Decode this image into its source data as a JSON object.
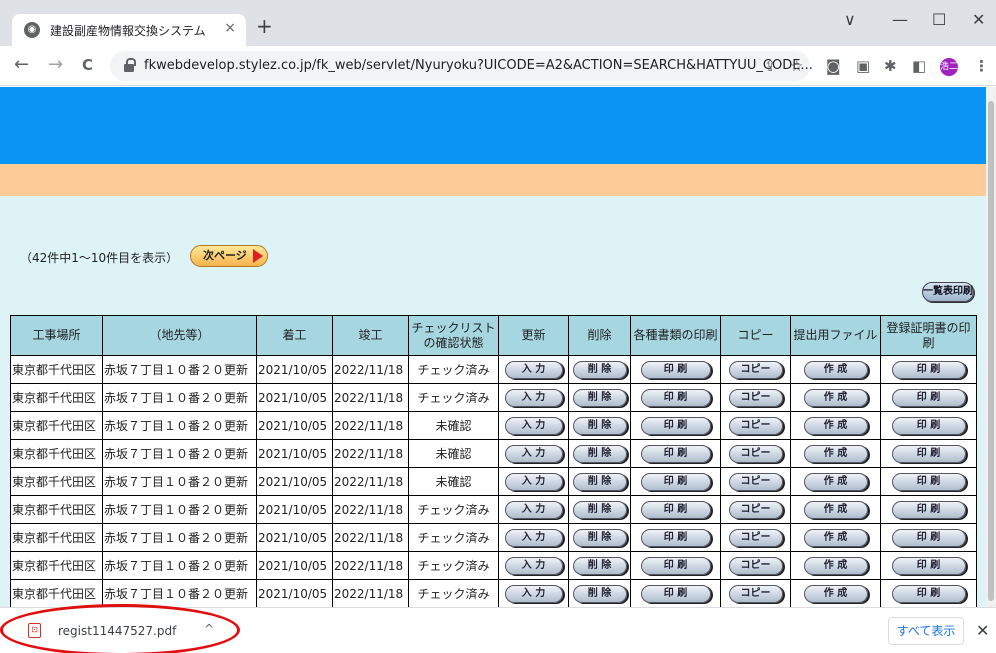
{
  "browser": {
    "tab_title": "建設副産物情報交換システム",
    "tab_close": "×",
    "new_tab": "+",
    "window_controls": {
      "chevron": "∨",
      "minimize": "—",
      "maximize": "☐",
      "close": "✕"
    },
    "back": "←",
    "forward": "→",
    "reload": "C",
    "url": "fkwebdevelop.stylez.co.jp/fk_web/servlet/Nyuryoku?UICODE=A2&ACTION=SEARCH&HATTYUU_CODE...",
    "toolbar_icons": [
      "share-icon",
      "star-icon",
      "camera-icon",
      "extension-icon",
      "puzzle-icon",
      "sidebar-icon"
    ],
    "share_glyph": "⇪",
    "star_glyph": "☆",
    "camera_glyph": "◙",
    "extension_glyph": "▣",
    "puzzle_glyph": "✱",
    "sidebar_glyph": "◧",
    "profile_label": "浩二",
    "menu_glyph": "⋮",
    "accent_color": "#1a73e8"
  },
  "page": {
    "colors": {
      "header_blue": "#0b96f6",
      "header_peach": "#fbcc98",
      "background": "#def3f6",
      "table_header": "#a6d6e0"
    },
    "count_text": "（42件中1～10件目を表示）",
    "next_page_label": "次ページ",
    "list_print_label": "一覧表印刷",
    "table": {
      "headers": [
        "工事場所",
        "（地先等）",
        "着工",
        "竣工",
        "チェックリスト\nの確認状態",
        "更新",
        "削除",
        "各種書類の印刷",
        "コピー",
        "提出用ファイル",
        "登録証明書の印刷"
      ],
      "buttons": {
        "update": "入 力",
        "delete": "削 除",
        "print": "印 刷",
        "copy": "コピー",
        "create": "作 成",
        "cert_print": "印 刷"
      },
      "rows": [
        {
          "place": "東京都千代田区",
          "detail": "赤坂７丁目１０番２０更新",
          "start": "2021/10/05",
          "end": "2022/11/18",
          "status": "チェック済み"
        },
        {
          "place": "東京都千代田区",
          "detail": "赤坂７丁目１０番２０更新",
          "start": "2021/10/05",
          "end": "2022/11/18",
          "status": "チェック済み"
        },
        {
          "place": "東京都千代田区",
          "detail": "赤坂７丁目１０番２０更新",
          "start": "2021/10/05",
          "end": "2022/11/18",
          "status": "未確認"
        },
        {
          "place": "東京都千代田区",
          "detail": "赤坂７丁目１０番２０更新",
          "start": "2021/10/05",
          "end": "2022/11/18",
          "status": "未確認"
        },
        {
          "place": "東京都千代田区",
          "detail": "赤坂７丁目１０番２０更新",
          "start": "2021/10/05",
          "end": "2022/11/18",
          "status": "未確認"
        },
        {
          "place": "東京都千代田区",
          "detail": "赤坂７丁目１０番２０更新",
          "start": "2021/10/05",
          "end": "2022/11/18",
          "status": "チェック済み"
        },
        {
          "place": "東京都千代田区",
          "detail": "赤坂７丁目１０番２０更新",
          "start": "2021/10/05",
          "end": "2022/11/18",
          "status": "チェック済み"
        },
        {
          "place": "東京都千代田区",
          "detail": "赤坂７丁目１０番２０更新",
          "start": "2021/10/05",
          "end": "2022/11/18",
          "status": "チェック済み"
        },
        {
          "place": "東京都千代田区",
          "detail": "赤坂７丁目１０番２０更新",
          "start": "2021/10/05",
          "end": "2022/11/18",
          "status": "チェック済み"
        }
      ]
    }
  },
  "downloads": {
    "filename": "regist11447527.pdf",
    "file_icon": "pdf-icon",
    "pdf_glyph": "⊡",
    "chevron_glyph": "^",
    "show_all": "すべて表示",
    "close_glyph": "✕",
    "highlight_color": "#e01010"
  }
}
